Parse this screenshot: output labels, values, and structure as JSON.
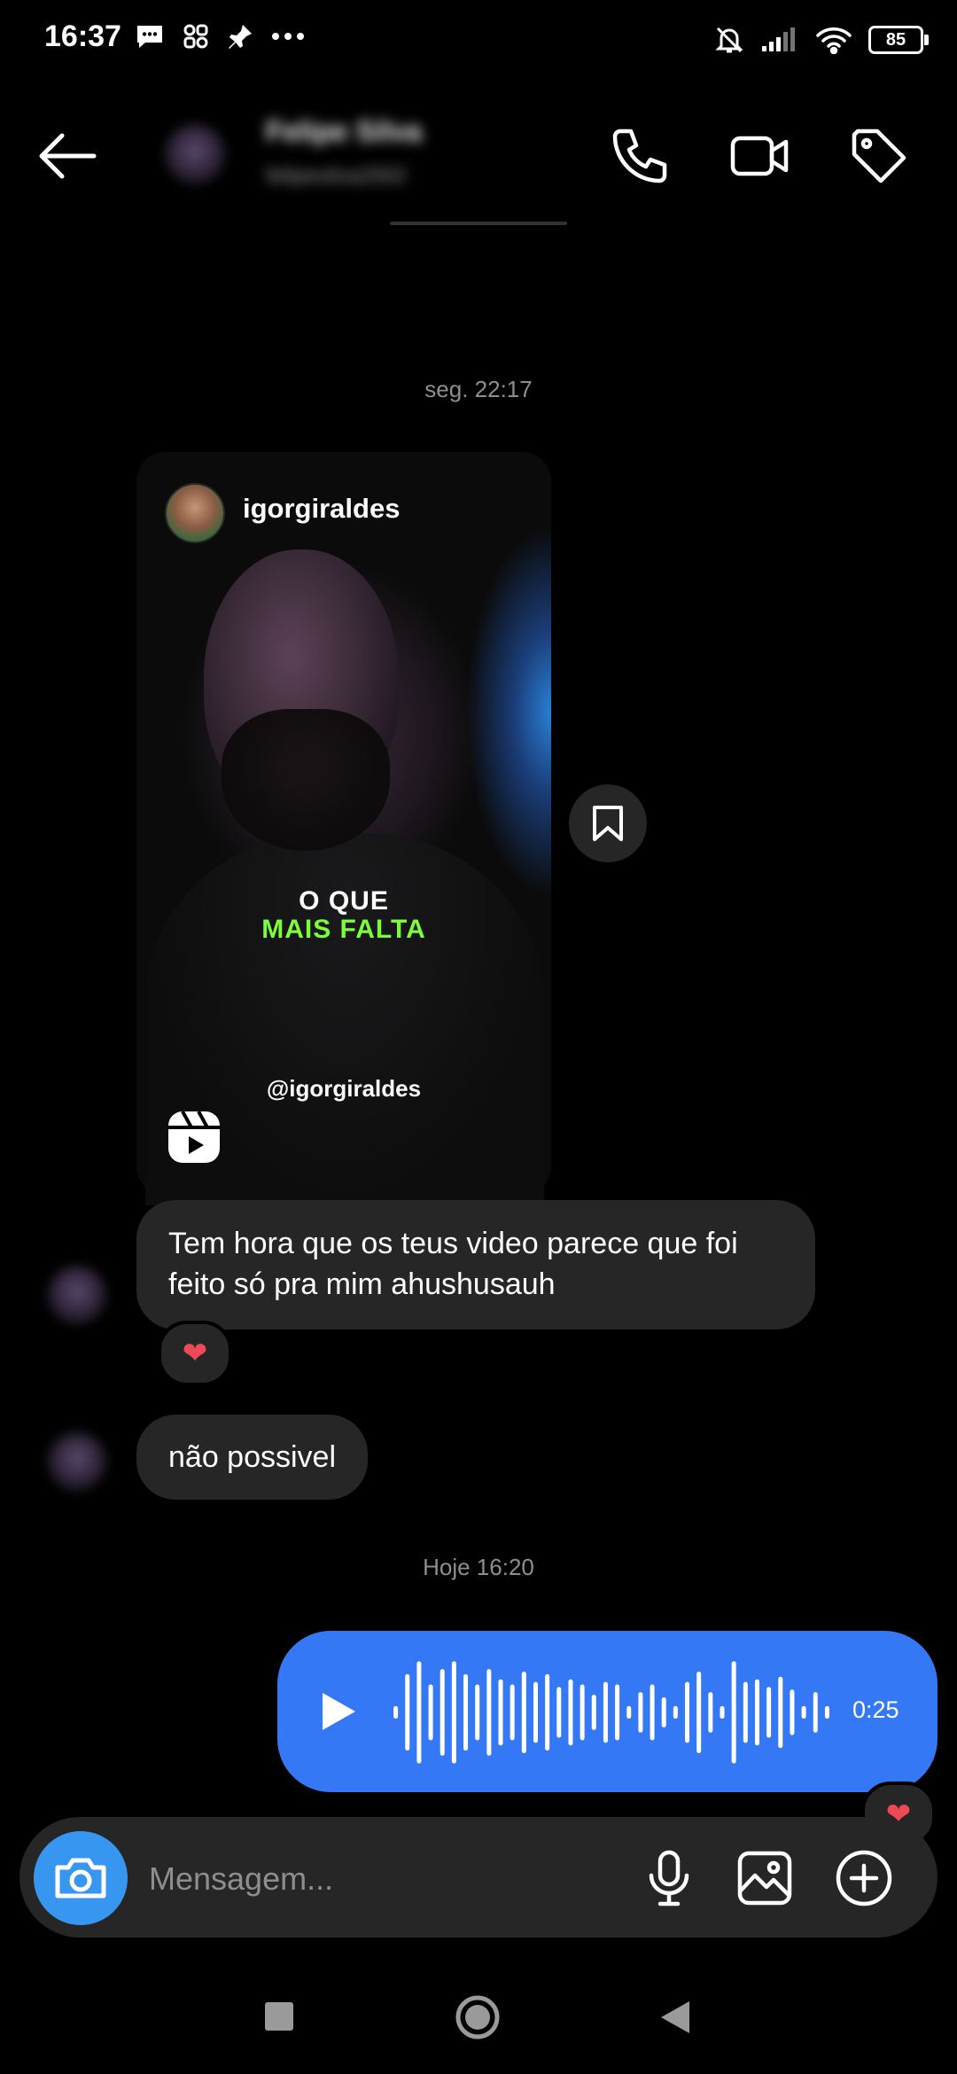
{
  "status_bar": {
    "time": "16:37",
    "battery": "85"
  },
  "header": {
    "contact_name": "Felipe Silva",
    "contact_handle": "felipesilva2002"
  },
  "messages": {
    "timestamp_1": "seg. 22:17",
    "reel": {
      "owner": "igorgiraldes",
      "caption_line_1": "O QUE",
      "caption_line_2": "MAIS FALTA",
      "handle_overlay": "@igorgiraldes"
    },
    "bubble_1": "Tem hora que os teus video parece que foi feito só pra mim ahushusauh",
    "bubble_1_reaction": "❤",
    "bubble_2": "não possivel",
    "timestamp_2": "Hoje 16:20",
    "audio": {
      "duration": "0:25",
      "reaction": "❤"
    }
  },
  "composer": {
    "placeholder": "Mensagem..."
  },
  "colors": {
    "background": "#000000",
    "incoming_bubble": "#262626",
    "outgoing_bubble": "#3478f6",
    "camera_button": "#3797f0",
    "caption_accent": "#7CFC3A",
    "heart": "#ed4956"
  },
  "icons": [
    "message-icon",
    "apps-icon",
    "pin-icon",
    "more-icon",
    "mute-icon",
    "signal-icon",
    "wifi-icon",
    "battery-icon",
    "back-arrow-icon",
    "phone-icon",
    "video-call-icon",
    "tag-icon",
    "reels-icon",
    "bookmark-icon",
    "play-icon",
    "camera-icon",
    "microphone-icon",
    "gallery-icon",
    "plus-circle-icon",
    "nav-recents-icon",
    "nav-home-icon",
    "nav-back-icon"
  ]
}
